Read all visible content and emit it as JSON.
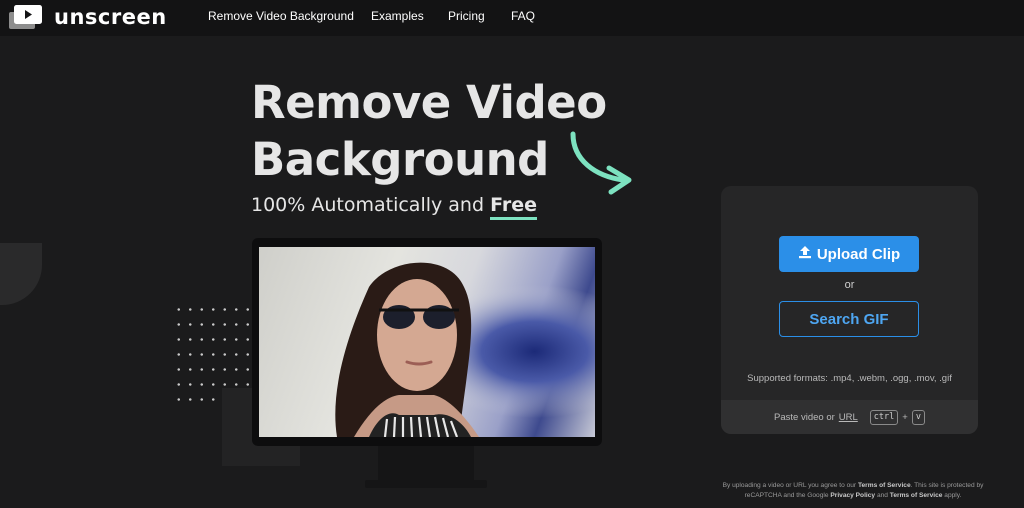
{
  "brand": {
    "name": "unscreen",
    "logo_icon": "play-stack-icon"
  },
  "nav": {
    "items": [
      {
        "label": "Remove Video Background"
      },
      {
        "label": "Examples"
      },
      {
        "label": "Pricing"
      },
      {
        "label": "FAQ"
      }
    ]
  },
  "hero": {
    "title_line1": "Remove Video",
    "title_line2": "Background",
    "subtitle_prefix": "100% Automatically and",
    "subtitle_free": "Free",
    "arrow_icon": "curved-arrow-icon",
    "accent_color": "#7de2c0"
  },
  "upload": {
    "upload_label": "Upload Clip",
    "upload_icon": "upload-icon",
    "or_label": "or",
    "search_label": "Search GIF",
    "formats_text": "Supported formats: .mp4, .webm, .ogg, .mov, .gif",
    "paste_prefix": "Paste video or",
    "url_label": "URL",
    "key_ctrl": "ctrl",
    "key_plus": "+",
    "key_v": "v",
    "button_color": "#2b8fe8"
  },
  "legal": {
    "part1": "By uploading a video or URL you agree to our",
    "terms1": "Terms of Service",
    "part2": ". This site is protected by reCAPTCHA and the Google",
    "privacy": "Privacy Policy",
    "part3": "and",
    "terms2": "Terms of Service",
    "part4": "apply."
  }
}
